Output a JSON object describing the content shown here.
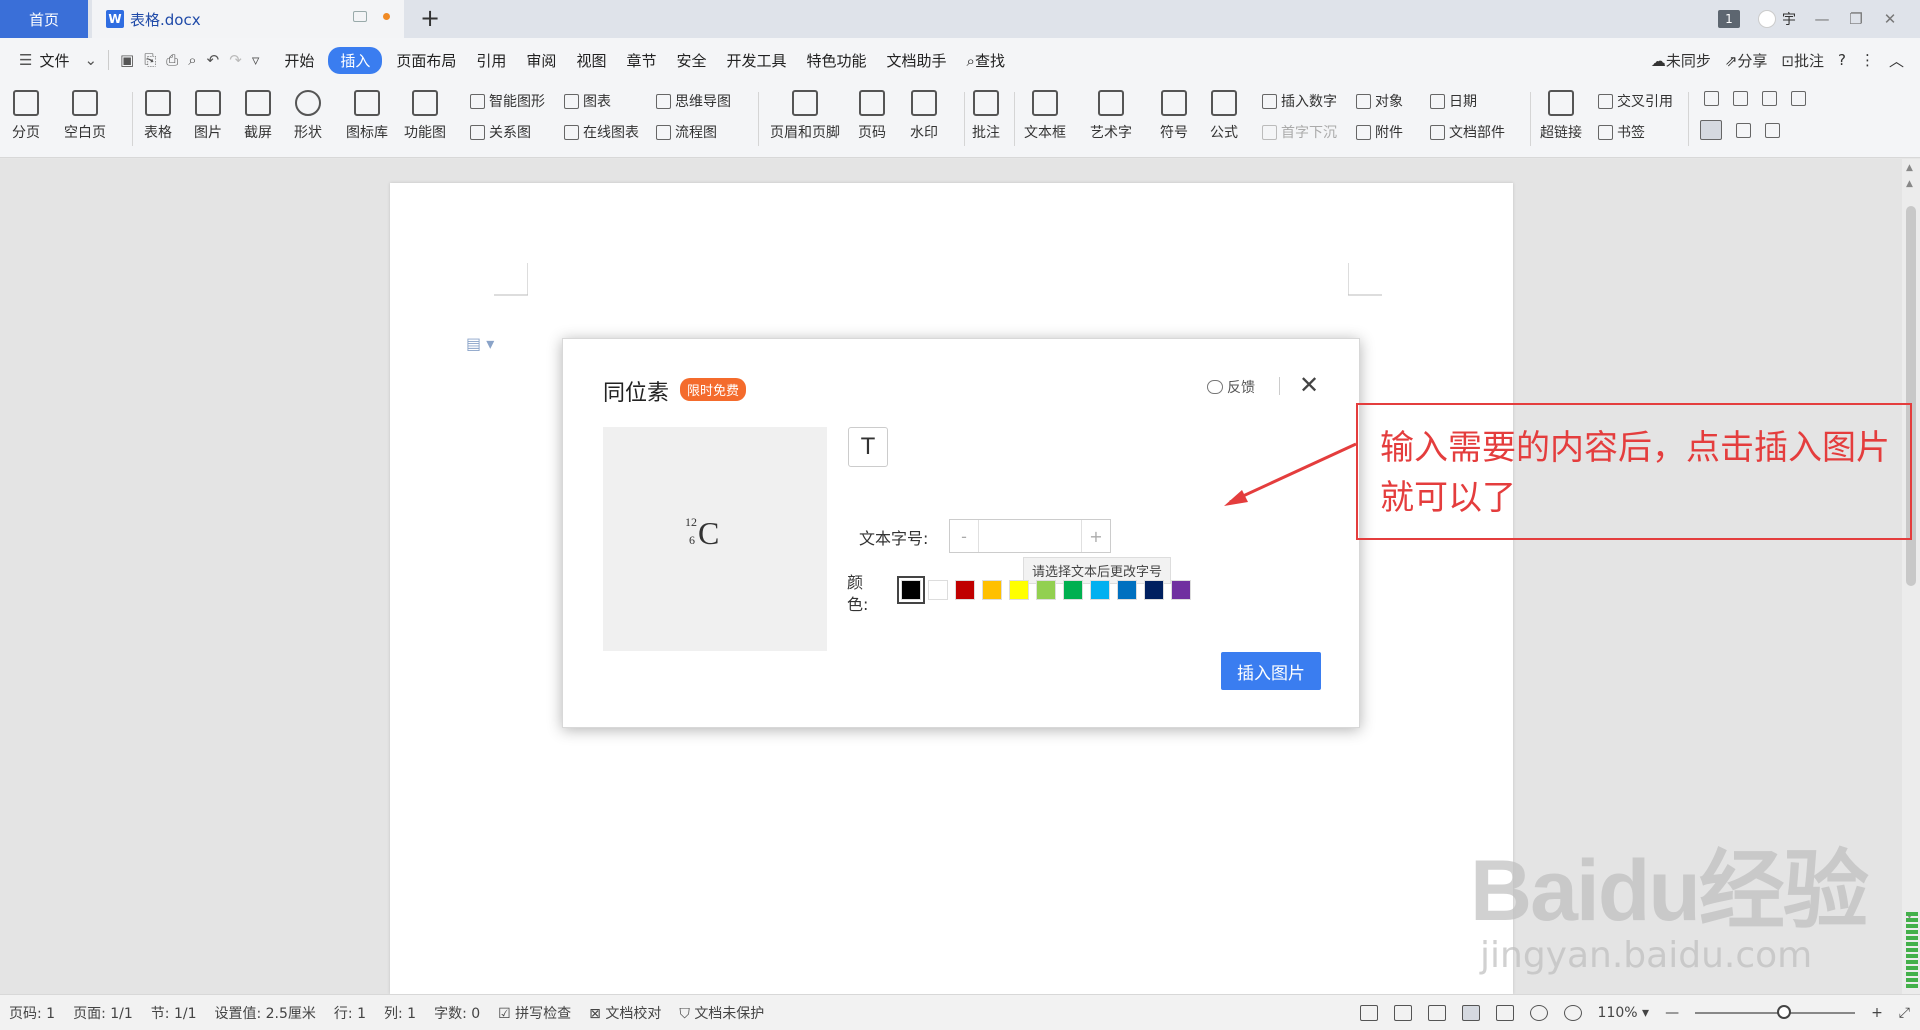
{
  "tabs": {
    "home": "首页",
    "doc": "表格.docx",
    "badge_count": "1",
    "user": "宇"
  },
  "menu": {
    "file": "文件",
    "items": [
      "开始",
      "插入",
      "页面布局",
      "引用",
      "审阅",
      "视图",
      "章节",
      "安全",
      "开发工具",
      "特色功能",
      "文档助手"
    ],
    "search": "查找",
    "right": [
      "未同步",
      "分享",
      "批注"
    ]
  },
  "ribbon": {
    "big": [
      "分页",
      "空白页",
      "表格",
      "图片",
      "截屏",
      "形状",
      "图标库",
      "功能图",
      "页眉和页脚",
      "页码",
      "水印",
      "批注",
      "文本框",
      "艺术字",
      "符号",
      "公式",
      "超链接"
    ],
    "small": [
      "智能图形",
      "图表",
      "思维导图",
      "关系图",
      "在线图表",
      "流程图",
      "插入数字",
      "对象",
      "日期",
      "首字下沉",
      "附件",
      "文档部件",
      "交叉引用",
      "书签"
    ]
  },
  "dialog": {
    "title": "同位素",
    "badge": "限时免费",
    "feedback": "反馈",
    "preview": {
      "mass": "12",
      "atomic": "6",
      "symbol": "C"
    },
    "text_button": "T",
    "font_size_label": "文本字号:",
    "minus": "-",
    "plus": "+",
    "tooltip": "请选择文本后更改字号",
    "color_label": "颜色:",
    "colors": [
      "#000000",
      "#ffffff",
      "#c00000",
      "#ffc000",
      "#ffff00",
      "#92d050",
      "#00b050",
      "#00b0f0",
      "#0070c0",
      "#002060",
      "#7030a0"
    ],
    "insert_button": "插入图片"
  },
  "annotation": {
    "text": "输入需要的内容后，点击插入图片就可以了"
  },
  "status": {
    "items": [
      "页码: 1",
      "页面: 1/1",
      "节: 1/1",
      "设置值: 2.5厘米",
      "行: 1",
      "列: 1",
      "字数: 0",
      "拼写检查",
      "文档校对",
      "文档未保护"
    ],
    "zoom": "110%"
  },
  "watermark": {
    "main": "Baidu经验",
    "sub": "jingyan.baidu.com"
  }
}
